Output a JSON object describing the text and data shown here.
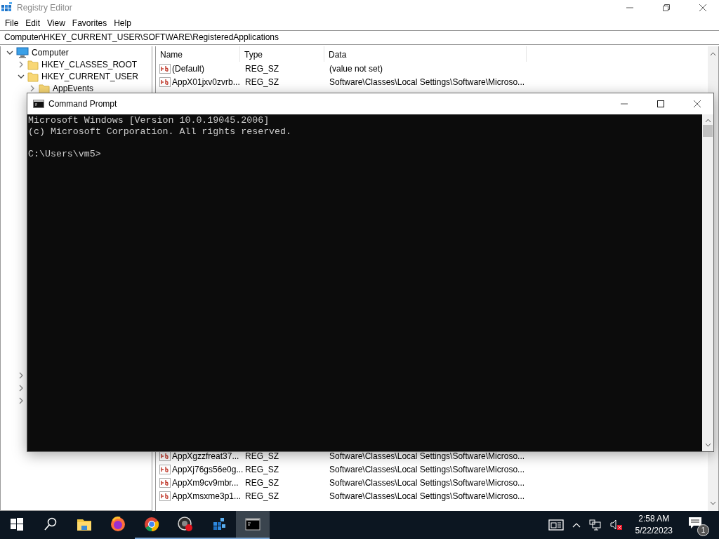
{
  "regedit": {
    "title": "Registry Editor",
    "active": false,
    "menu": [
      "File",
      "Edit",
      "View",
      "Favorites",
      "Help"
    ],
    "address": "Computer\\HKEY_CURRENT_USER\\SOFTWARE\\RegisteredApplications",
    "tree": [
      {
        "label": "Computer",
        "kind": "computer",
        "expanded": true,
        "children": [
          {
            "label": "HKEY_CLASSES_ROOT",
            "kind": "folder",
            "expanded": false
          },
          {
            "label": "HKEY_CURRENT_USER",
            "kind": "folder",
            "expanded": true,
            "children": [
              {
                "label": "AppEvents",
                "kind": "folder",
                "expanded": false
              }
            ]
          }
        ]
      }
    ],
    "tree_hidden_rows": [
      {
        "expanded": false
      },
      {
        "expanded": false
      },
      {
        "expanded": false
      }
    ],
    "columns": [
      "Name",
      "Type",
      "Data"
    ],
    "rows_top": [
      {
        "name": "(Default)",
        "type": "REG_SZ",
        "data": "(value not set)"
      },
      {
        "name": "AppX01jxv0zvrb...",
        "type": "REG_SZ",
        "data": "Software\\Classes\\Local Settings\\Software\\Microso..."
      }
    ],
    "rows_bottom": [
      {
        "name": "AppXgzzfreat37...",
        "type": "REG_SZ",
        "data": "Software\\Classes\\Local Settings\\Software\\Microso..."
      },
      {
        "name": "AppXj76gs56e0g...",
        "type": "REG_SZ",
        "data": "Software\\Classes\\Local Settings\\Software\\Microso..."
      },
      {
        "name": "AppXm9cv9mbr...",
        "type": "REG_SZ",
        "data": "Software\\Classes\\Local Settings\\Software\\Microso..."
      },
      {
        "name": "AppXmsxme3p1...",
        "type": "REG_SZ",
        "data": "Software\\Classes\\Local Settings\\Software\\Microso..."
      }
    ]
  },
  "cmd": {
    "title": "Command Prompt",
    "active": true,
    "output": "Microsoft Windows [Version 10.0.19045.2006]\n(c) Microsoft Corporation. All rights reserved.\n\nC:\\Users\\vm5>"
  },
  "taskbar": {
    "apps": [
      {
        "kind": "start",
        "running": false,
        "selected": false
      },
      {
        "kind": "search",
        "running": false,
        "selected": false
      },
      {
        "kind": "explorer",
        "running": false,
        "selected": false
      },
      {
        "kind": "firefox",
        "running": false,
        "selected": false
      },
      {
        "kind": "chrome",
        "running": true,
        "selected": false
      },
      {
        "kind": "recorder",
        "running": true,
        "selected": false
      },
      {
        "kind": "regedit",
        "running": true,
        "selected": false
      },
      {
        "kind": "cmd",
        "running": true,
        "selected": true
      }
    ],
    "time": "2:58 AM",
    "date": "5/22/2023",
    "notifications": "1"
  }
}
